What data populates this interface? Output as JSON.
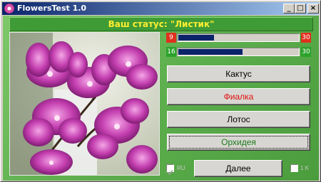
{
  "window": {
    "title": "FlowersTest 1.0",
    "controls": {
      "minimize": "_",
      "maximize": "□",
      "close": "×"
    }
  },
  "status": {
    "text": "Ваш статус: \"Листик\""
  },
  "progress": [
    {
      "current": "9",
      "total": "30",
      "fraction": 0.3,
      "current_color": "#e0301e",
      "total_color": "#e0301e"
    },
    {
      "current": "16",
      "total": "30",
      "fraction": 0.533,
      "current_color": "#2aa32a",
      "total_color": "#2aa32a"
    }
  ],
  "photo": {
    "subject": "orchid",
    "icon": "flower-photo"
  },
  "answers": [
    {
      "label": "Кактус",
      "color": "#000000",
      "focused": false
    },
    {
      "label": "Фиалка",
      "color": "#e01010",
      "focused": false
    },
    {
      "label": "Лотос",
      "color": "#000000",
      "focused": false
    },
    {
      "label": "Орхидея",
      "color": "#1a7a1a",
      "focused": true
    }
  ],
  "options": {
    "left_check": {
      "label": "RU",
      "checked": true
    },
    "right_check": {
      "label": "1 K",
      "checked": false
    }
  },
  "next_button": {
    "label": "Далее"
  }
}
